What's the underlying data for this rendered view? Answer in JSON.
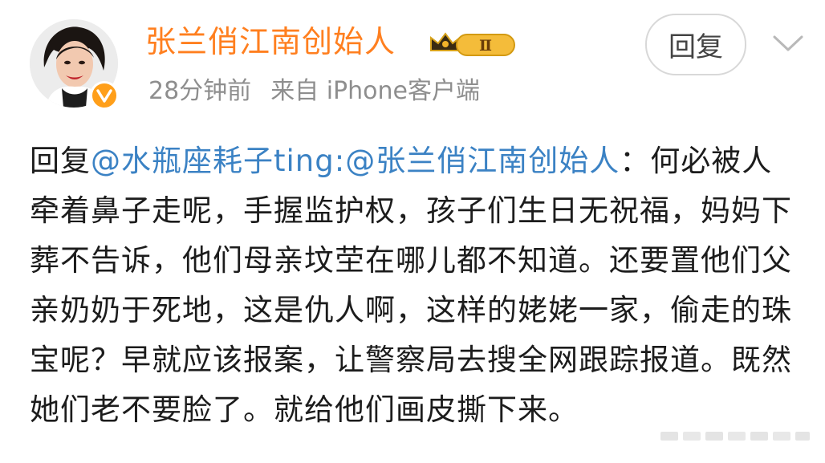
{
  "user": {
    "name": "张兰俏江南创始人",
    "level_badge": "Ⅱ",
    "verified_icon": "verified-v-icon",
    "avatar_icon": "avatar-portrait"
  },
  "meta": {
    "time": "28分钟前",
    "source": "来自 iPhone客户端"
  },
  "actions": {
    "reply_label": "回复",
    "dropdown_icon": "chevron-down-icon"
  },
  "post": {
    "prefix": "回复",
    "mention1": "@水瓶座耗子ting",
    "sep": ":",
    "mention2": "@张兰俏江南创始人",
    "body": "：何必被人牵着鼻子走呢，手握监护权，孩子们生日无祝福，妈妈下葬不告诉，他们母亲坟茔在哪儿都不知道。还要置他们父亲奶奶于死地，这是仇人啊，这样的姥姥一家，偷走的珠宝呢？早就应该报案，让警察局去搜全网跟踪报道。既然她们老不要脸了。就给他们画皮撕下来。"
  },
  "colors": {
    "username": "#ff7f1f",
    "mention": "#3b82c4",
    "meta": "#8e8e8e",
    "badge": "#ff9f1a"
  }
}
